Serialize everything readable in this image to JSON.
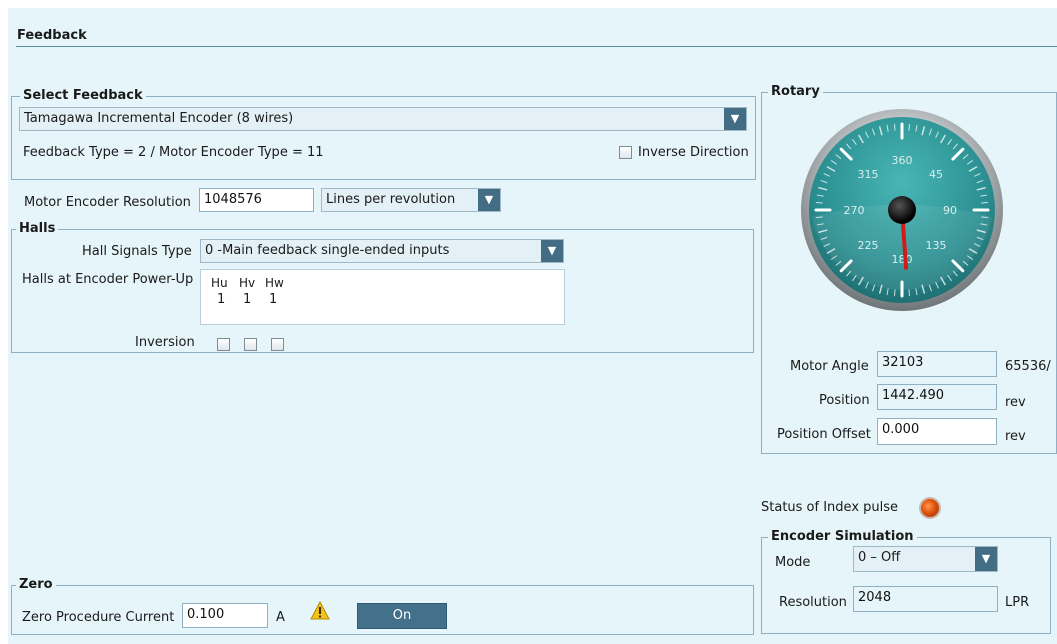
{
  "title": "Feedback",
  "select_feedback": {
    "legend": "Select Feedback",
    "selected": "Tamagawa Incremental Encoder (8 wires)",
    "type_text": "Feedback Type =  2  /  Motor Encoder Type  =  11",
    "inverse_label": "Inverse Direction"
  },
  "resolution": {
    "label": "Motor Encoder Resolution",
    "value": "1048576",
    "unit_selected": "Lines per revolution"
  },
  "halls": {
    "legend": "Halls",
    "signals_label": "Hall Signals Type",
    "signals_selected": "0  -Main feedback single-ended inputs",
    "powerup_label": "Halls at Encoder Power-Up",
    "columns": [
      {
        "name": "Hu",
        "value": "1"
      },
      {
        "name": "Hv",
        "value": "1"
      },
      {
        "name": "Hw",
        "value": "1"
      }
    ],
    "inversion_label": "Inversion"
  },
  "zero": {
    "legend": "Zero",
    "current_label": "Zero Procedure Current",
    "current_value": "0.100",
    "current_unit": "A",
    "button_label": "On"
  },
  "rotary": {
    "legend": "Rotary",
    "dial_labels": [
      "360",
      "45",
      "90",
      "135",
      "180",
      "225",
      "270",
      "315"
    ],
    "needle_angle_deg": 176,
    "motor_angle_label": "Motor Angle",
    "motor_angle_value": "32103",
    "motor_angle_unit": "65536/",
    "position_label": "Position",
    "position_value": "1442.490",
    "position_unit": "rev",
    "offset_label": "Position Offset",
    "offset_value": "0.000",
    "offset_unit": "rev"
  },
  "index_pulse": {
    "label": "Status of Index pulse"
  },
  "encoder_sim": {
    "legend": "Encoder Simulation",
    "mode_label": "Mode",
    "mode_selected": "0 – Off",
    "resolution_label": "Resolution",
    "resolution_value": "2048",
    "resolution_unit": "LPR"
  },
  "colors": {
    "panel_bg": "#e6f5fa",
    "accent": "#426d85",
    "dial_face": "#2f9a9c",
    "needle": "#d11a1a"
  }
}
